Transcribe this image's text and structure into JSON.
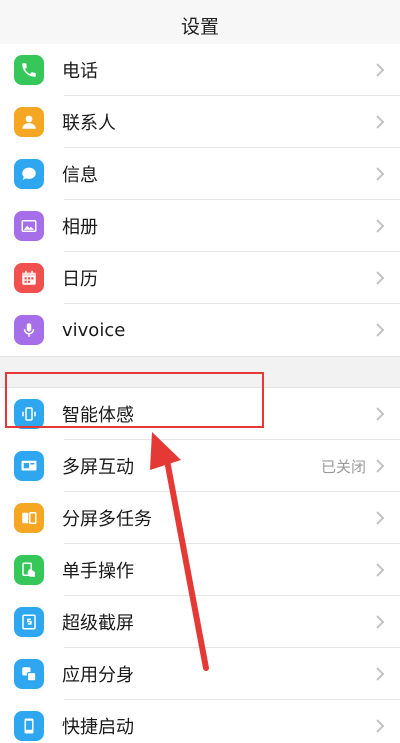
{
  "header": {
    "title": "设置"
  },
  "colors": {
    "red_annotation": "#e53935",
    "divider": "#e6e6e6",
    "section_gap": "#f2f2f2"
  },
  "group1": [
    {
      "id": "phone",
      "label": "电话",
      "icon": "phone-icon",
      "color": "#35c759"
    },
    {
      "id": "contacts",
      "label": "联系人",
      "icon": "contacts-icon",
      "color": "#f5a623"
    },
    {
      "id": "messages",
      "label": "信息",
      "icon": "message-icon",
      "color": "#2fa7f0"
    },
    {
      "id": "album",
      "label": "相册",
      "icon": "album-icon",
      "color": "#a66ee8"
    },
    {
      "id": "calendar",
      "label": "日历",
      "icon": "calendar-icon",
      "color": "#f0514f"
    },
    {
      "id": "vivoice",
      "label": "vivoice",
      "icon": "microphone-icon",
      "color": "#a66ee8"
    }
  ],
  "group2": [
    {
      "id": "smart-motion",
      "label": "智能体感",
      "icon": "smart-motion-icon",
      "color": "#2fa7f0",
      "status": ""
    },
    {
      "id": "multi-screen",
      "label": "多屏互动",
      "icon": "multi-screen-icon",
      "color": "#2fa7f0",
      "status": "已关闭"
    },
    {
      "id": "split-screen",
      "label": "分屏多任务",
      "icon": "split-screen-icon",
      "color": "#f5a623",
      "status": ""
    },
    {
      "id": "one-hand",
      "label": "单手操作",
      "icon": "one-hand-icon",
      "color": "#35c759",
      "status": ""
    },
    {
      "id": "super-screenshot",
      "label": "超级截屏",
      "icon": "screenshot-icon",
      "color": "#2fa7f0",
      "status": ""
    },
    {
      "id": "app-clone",
      "label": "应用分身",
      "icon": "app-clone-icon",
      "color": "#2fa7f0",
      "status": ""
    },
    {
      "id": "quick-launch",
      "label": "快捷启动",
      "icon": "quick-launch-icon",
      "color": "#2fa7f0",
      "status": ""
    }
  ]
}
